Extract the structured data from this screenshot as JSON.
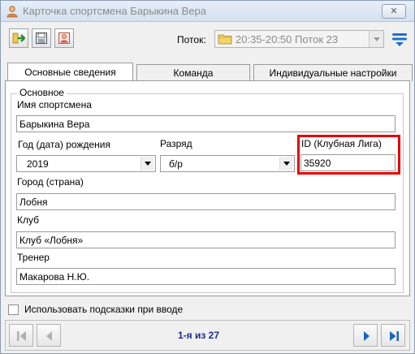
{
  "window": {
    "title": "Карточка спортсмена Барыкина Вера",
    "close_glyph": "✕"
  },
  "toolbar": {
    "buttons": [
      "exit-icon",
      "save-icon",
      "person-card-icon"
    ],
    "flow_label": "Поток:",
    "flow_value": "20:35-20:50 Поток 23",
    "filter_icon": "filter-icon"
  },
  "tabs": [
    {
      "label": "Основные сведения",
      "active": true
    },
    {
      "label": "Команда",
      "active": false
    },
    {
      "label": "Индивидуальные настройки",
      "active": false
    }
  ],
  "group": {
    "legend": "Основное"
  },
  "fields": {
    "name": {
      "label": "Имя спортсмена",
      "value": "Барыкина Вера"
    },
    "birth": {
      "label": "Год (дата) рождения",
      "value": "2019"
    },
    "rank": {
      "label": "Разряд",
      "value": "б/р"
    },
    "club_id": {
      "label": "ID (Клубная Лига)",
      "value": "35920"
    },
    "city": {
      "label": "Город (страна)",
      "value": "Лобня"
    },
    "club": {
      "label": "Клуб",
      "value": "Клуб «Лобня»"
    },
    "coach": {
      "label": "Тренер",
      "value": "Макарова Н.Ю."
    }
  },
  "hints": {
    "label": "Использовать подсказки при вводе",
    "checked": false
  },
  "navigation": {
    "counter": "1-я из 27"
  },
  "colors": {
    "highlight": "#e60000",
    "nav_arrow_active": "#1565c0",
    "nav_arrow_disabled": "#b0b0b0"
  }
}
